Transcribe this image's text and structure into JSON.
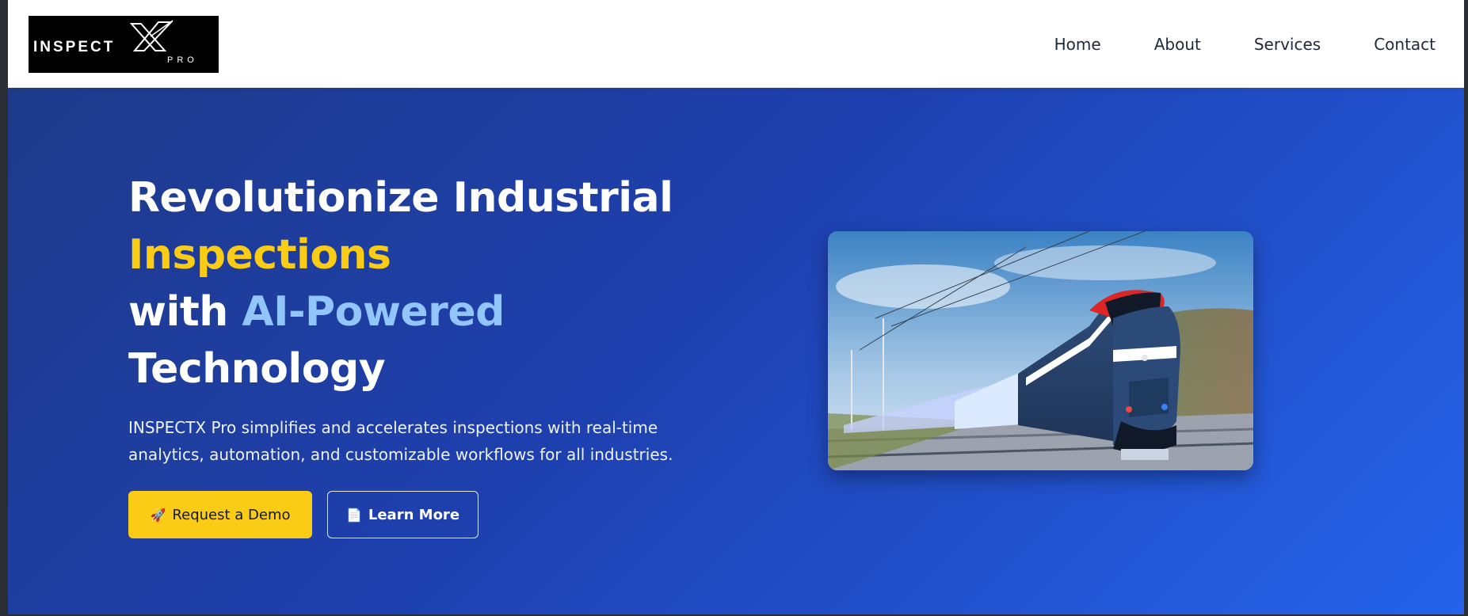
{
  "brand": {
    "logo_word": "INSPECT",
    "logo_x": "X",
    "logo_sub": "PRO"
  },
  "nav": {
    "items": [
      {
        "label": "Home"
      },
      {
        "label": "About"
      },
      {
        "label": "Services"
      },
      {
        "label": "Contact"
      }
    ]
  },
  "hero": {
    "title_line1": "Revolutionize Industrial",
    "title_highlight": "Inspections",
    "title_with": "with",
    "title_ai": "AI-Powered",
    "title_line4": "Technology",
    "description": "INSPECTX Pro simplifies and accelerates inspections with real-time analytics, automation, and customizable workflows for all industries.",
    "primary_button": {
      "icon": "🚀",
      "label": "Request a Demo"
    },
    "secondary_button": {
      "icon": "📄",
      "label": "Learn More"
    }
  },
  "colors": {
    "accent_yellow": "#facc15",
    "accent_light_blue": "#93c5fd",
    "hero_gradient_start": "#1e3a8a",
    "hero_gradient_end": "#2563eb"
  },
  "icons": {
    "primary_button": "rocket-icon",
    "secondary_button": "document-icon"
  }
}
